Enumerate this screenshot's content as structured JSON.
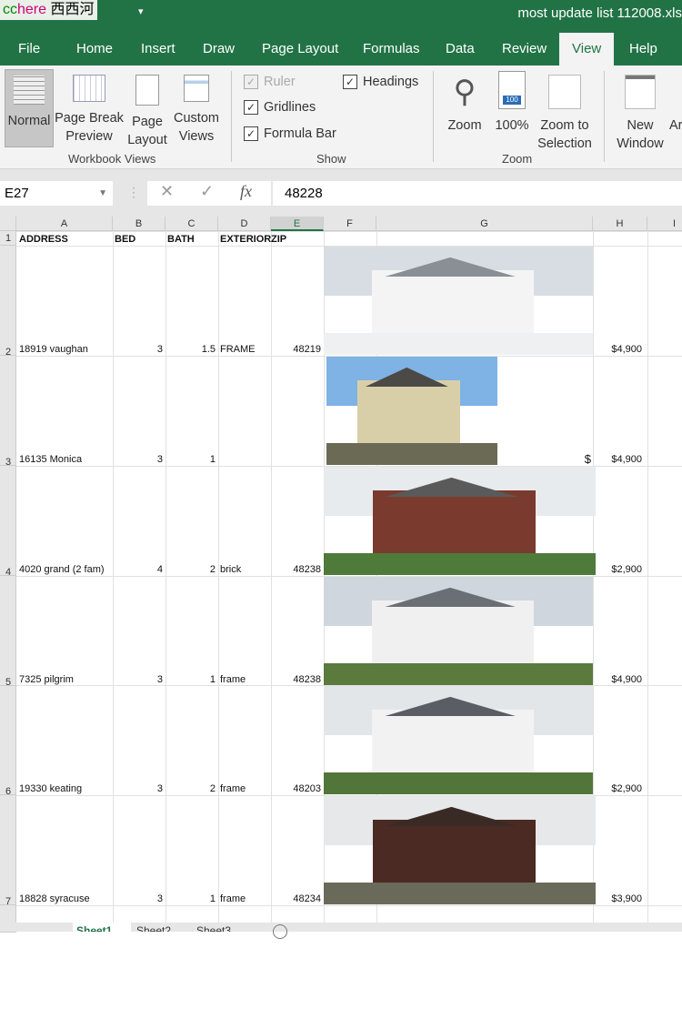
{
  "watermark": "cchere 西西河",
  "window_title": "most update list 112008.xls",
  "ribbon_tabs": [
    "File",
    "Home",
    "Insert",
    "Draw",
    "Page Layout",
    "Formulas",
    "Data",
    "Review",
    "View",
    "Help"
  ],
  "active_tab": "View",
  "workbook_views": {
    "label": "Workbook Views",
    "buttons": [
      "Normal",
      "Page Break Preview",
      "Page Layout",
      "Custom Views"
    ]
  },
  "show": {
    "label": "Show",
    "ruler": "Ruler",
    "headings": "Headings",
    "gridlines": "Gridlines",
    "formula_bar": "Formula Bar",
    "ruler_checked": true,
    "headings_checked": true,
    "gridlines_checked": true,
    "formula_bar_checked": true
  },
  "zoom": {
    "label": "Zoom",
    "buttons": [
      "Zoom",
      "100%",
      "Zoom to Selection"
    ]
  },
  "window": {
    "buttons": [
      "New Window",
      "Ar"
    ]
  },
  "formula": {
    "name_box": "E27",
    "fx": "fx",
    "value": "48228"
  },
  "columns": [
    "A",
    "B",
    "C",
    "D",
    "E",
    "F",
    "G",
    "H",
    "I"
  ],
  "selected_column": "E",
  "header_row": {
    "address": "ADDRESS",
    "bed": "BED",
    "bath": "BATH",
    "exterior": "EXTERIOR",
    "zip": "ZIP"
  },
  "rows": [
    {
      "n": "2",
      "address": "18919 vaughan",
      "bed": "3",
      "bath": "1.5",
      "exterior": "FRAME",
      "zip": "48219",
      "price": "$4,900",
      "g": ""
    },
    {
      "n": "3",
      "address": "16135 Monica",
      "bed": "3",
      "bath": "1",
      "exterior": "",
      "zip": "",
      "price": "$4,900",
      "g": "$"
    },
    {
      "n": "4",
      "address": "4020 grand (2 fam)",
      "bed": "4",
      "bath": "2",
      "exterior": "brick",
      "zip": "48238",
      "price": "$2,900",
      "g": ""
    },
    {
      "n": "5",
      "address": "7325 pilgrim",
      "bed": "3",
      "bath": "1",
      "exterior": "frame",
      "zip": "48238",
      "price": "$4,900",
      "g": ""
    },
    {
      "n": "6",
      "address": "19330 keating",
      "bed": "3",
      "bath": "2",
      "exterior": "frame",
      "zip": "48203",
      "price": "$2,900",
      "g": ""
    },
    {
      "n": "7",
      "address": "18828 syracuse",
      "bed": "3",
      "bath": "1",
      "exterior": "frame",
      "zip": "48234",
      "price": "$3,900",
      "g": ""
    }
  ],
  "sheet_tabs": [
    "Sheet1",
    "Sheet2",
    "Sheet3"
  ],
  "active_sheet": "Sheet1",
  "colors": {
    "excel_green": "#217346"
  }
}
